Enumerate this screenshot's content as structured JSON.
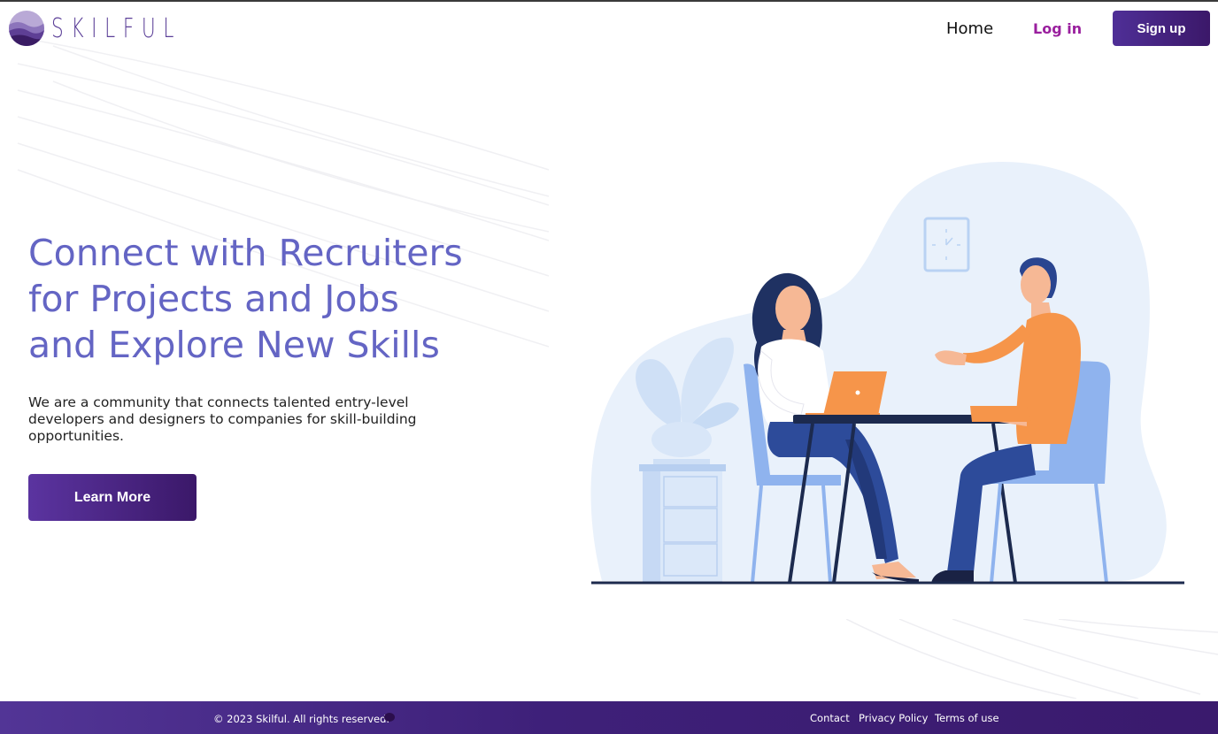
{
  "brand": {
    "name": "SKILFUL"
  },
  "nav": {
    "home_label": "Home",
    "login_label": "Log in",
    "signup_label": "Sign up"
  },
  "hero": {
    "title": "Connect with Recruiters\nfor Projects and Jobs\nand Explore New Skills",
    "subtitle": "We are a community that connects talented entry-level developers and designers to companies for skill-building opportunities.",
    "cta_label": "Learn More"
  },
  "footer": {
    "copyright": "© 2023 Skilful. All rights reserved.",
    "links": [
      "Contact",
      "Privacy Policy",
      "Terms of use"
    ]
  },
  "colors": {
    "brand_purple": "#4f2f97",
    "title_blue": "#6465c4",
    "login_magenta": "#9a1f9e"
  },
  "icons": [
    "logo-mark-icon",
    "clock-icon",
    "plant-icon",
    "laptop-icon"
  ]
}
